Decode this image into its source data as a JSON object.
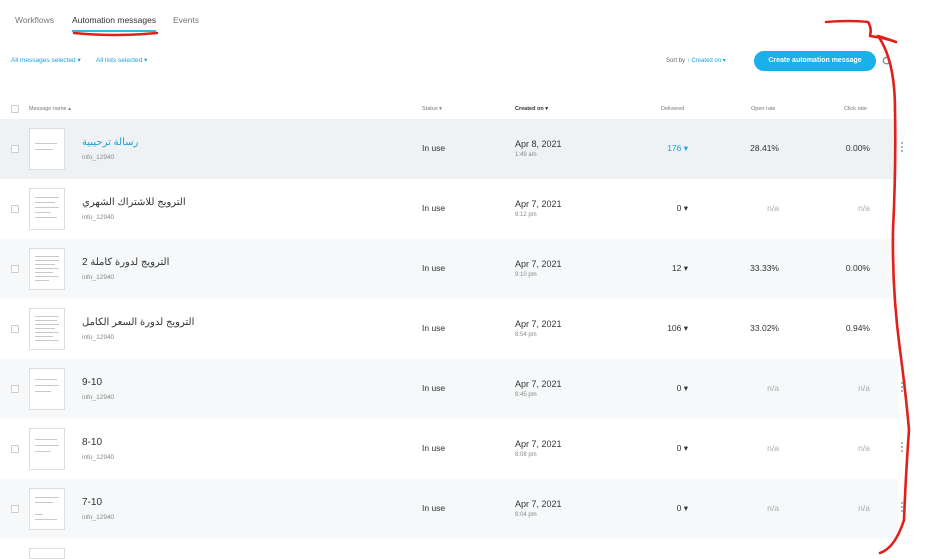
{
  "tabs": [
    {
      "label": "Workflows"
    },
    {
      "label": "Automation messages"
    },
    {
      "label": "Events"
    }
  ],
  "filters": {
    "messages": "All messages selected ▾",
    "lists": "All lists selected ▾",
    "sort_label": "Sort by",
    "sort_value": "↑ Created on ▾"
  },
  "actions": {
    "create": "Create automation message"
  },
  "columns": {
    "name": "Message name ▴",
    "status": "Status ▾",
    "created": "Created on ▾",
    "delivered": "Delivered",
    "open": "Open rate",
    "click": "Click rate"
  },
  "rows": [
    {
      "name": "رسالة ترحيبية",
      "owner": "info_12940",
      "status": "In use",
      "date": "Apr 8, 2021",
      "time": "1:49 am",
      "delivered": "176 ▾",
      "open": "28.41%",
      "click": "0.00%"
    },
    {
      "name": "الترويج للاشتراك الشهري",
      "owner": "info_12940",
      "status": "In use",
      "date": "Apr 7, 2021",
      "time": "9:12 pm",
      "delivered": "0 ▾",
      "open": "n/a",
      "click": "n/a"
    },
    {
      "name": "الترويج لدورة كاملة 2",
      "owner": "info_12940",
      "status": "In use",
      "date": "Apr 7, 2021",
      "time": "9:10 pm",
      "delivered": "12 ▾",
      "open": "33.33%",
      "click": "0.00%"
    },
    {
      "name": "الترويج لدورة السعر الكامل",
      "owner": "info_12940",
      "status": "In use",
      "date": "Apr 7, 2021",
      "time": "8:54 pm",
      "delivered": "106 ▾",
      "open": "33.02%",
      "click": "0.94%"
    },
    {
      "name": "9-10",
      "owner": "info_12940",
      "status": "In use",
      "date": "Apr 7, 2021",
      "time": "8:45 pm",
      "delivered": "0 ▾",
      "open": "n/a",
      "click": "n/a"
    },
    {
      "name": "8-10",
      "owner": "info_12940",
      "status": "In use",
      "date": "Apr 7, 2021",
      "time": "8:08 pm",
      "delivered": "0 ▾",
      "open": "n/a",
      "click": "n/a"
    },
    {
      "name": "7-10",
      "owner": "info_12940",
      "status": "In use",
      "date": "Apr 7, 2021",
      "time": "8:04 pm",
      "delivered": "0 ▾",
      "open": "n/a",
      "click": "n/a"
    }
  ],
  "colors": {
    "accent": "#1ab0ea",
    "annotation": "#e0201b"
  },
  "icons": {
    "search": "search-icon",
    "more": "kebab-menu-icon"
  }
}
